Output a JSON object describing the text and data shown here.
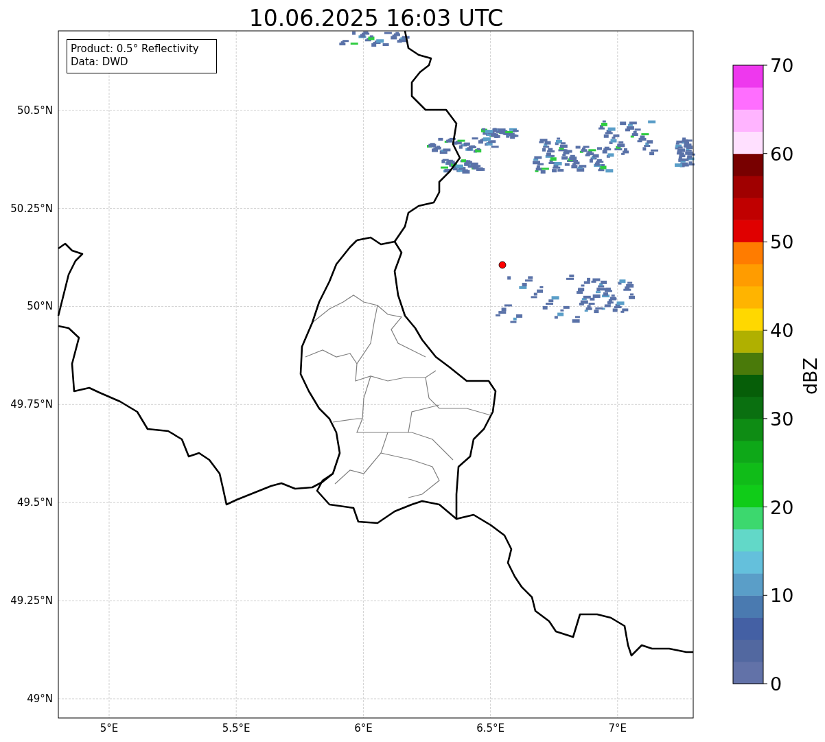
{
  "title": "10.06.2025 16:03 UTC",
  "info_box": [
    "Product: 0.5° Reflectivity",
    "Data: DWD"
  ],
  "map": {
    "lat_ticks": [
      "50.5°N",
      "50.25°N",
      "50°N",
      "49.75°N",
      "49.5°N",
      "49.25°N",
      "49°N"
    ],
    "lon_ticks": [
      "5°E",
      "5.5°E",
      "6°E",
      "6.5°E",
      "7°E"
    ]
  },
  "colorbar": {
    "label": "dBZ",
    "ticks": [
      "70",
      "60",
      "50",
      "40",
      "30",
      "20",
      "10",
      "0"
    ],
    "segments": [
      {
        "color": "#6272a8"
      },
      {
        "color": "#5268a0"
      },
      {
        "color": "#4460a4"
      },
      {
        "color": "#4a7ab0"
      },
      {
        "color": "#5a9ec8"
      },
      {
        "color": "#64c0dc"
      },
      {
        "color": "#62d8c8"
      },
      {
        "color": "#3cd86e"
      },
      {
        "color": "#10cc18"
      },
      {
        "color": "#10bc18"
      },
      {
        "color": "#0ea818"
      },
      {
        "color": "#0e8c14"
      },
      {
        "color": "#0a7010"
      },
      {
        "color": "#065e08"
      },
      {
        "color": "#4a7a0a"
      },
      {
        "color": "#b0b000"
      },
      {
        "color": "#ffd800"
      },
      {
        "color": "#ffb400"
      },
      {
        "color": "#ff9c00"
      },
      {
        "color": "#ff7c00"
      },
      {
        "color": "#e00000"
      },
      {
        "color": "#c00000"
      },
      {
        "color": "#a00000"
      },
      {
        "color": "#780000"
      },
      {
        "color": "#ffe0ff"
      },
      {
        "color": "#ffb4ff"
      },
      {
        "color": "#ff6eff"
      },
      {
        "color": "#ee38ee"
      }
    ]
  }
}
